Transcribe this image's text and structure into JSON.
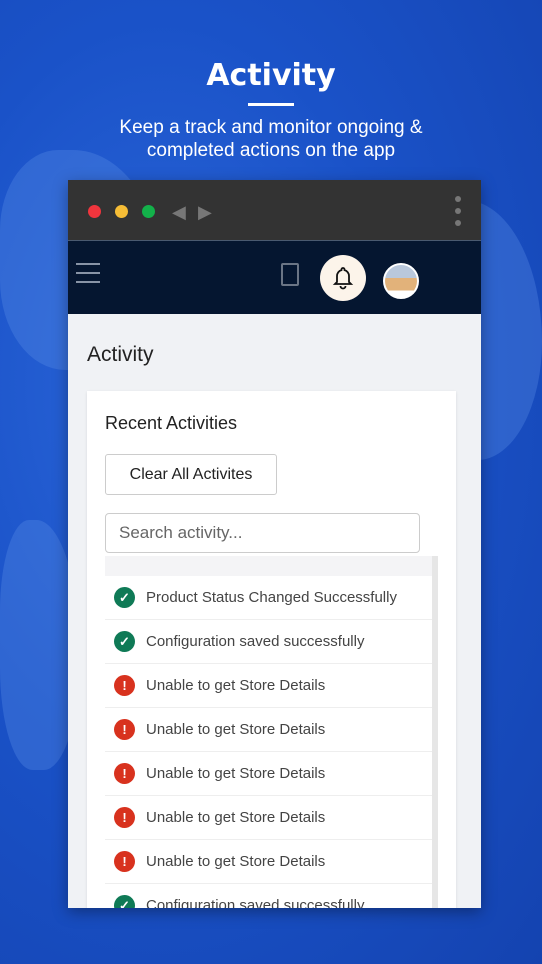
{
  "hero": {
    "title": "Activity",
    "subtitle_line1": "Keep a track and monitor ongoing &",
    "subtitle_line2": "completed actions on the app"
  },
  "colors": {
    "background": "#1a52c8",
    "header": "#051630",
    "success": "#0f7a56",
    "error": "#d8321e"
  },
  "browser": {
    "back": "◀",
    "forward": "▶"
  },
  "page": {
    "title": "Activity"
  },
  "card": {
    "title": "Recent Activities",
    "clear_label": "Clear All Activites",
    "search_placeholder": "Search activity..."
  },
  "activities": [
    {
      "status": "success",
      "icon": "check-circle-icon",
      "text": "Product Status Changed Successfully"
    },
    {
      "status": "success",
      "icon": "check-circle-icon",
      "text": "Configuration saved successfully"
    },
    {
      "status": "error",
      "icon": "exclamation-circle-icon",
      "text": "Unable to get Store Details"
    },
    {
      "status": "error",
      "icon": "exclamation-circle-icon",
      "text": "Unable to get Store Details"
    },
    {
      "status": "error",
      "icon": "exclamation-circle-icon",
      "text": "Unable to get Store Details"
    },
    {
      "status": "error",
      "icon": "exclamation-circle-icon",
      "text": "Unable to get Store Details"
    },
    {
      "status": "error",
      "icon": "exclamation-circle-icon",
      "text": "Unable to get Store Details"
    },
    {
      "status": "success",
      "icon": "check-circle-icon",
      "text": "Configuration saved successfully"
    }
  ]
}
